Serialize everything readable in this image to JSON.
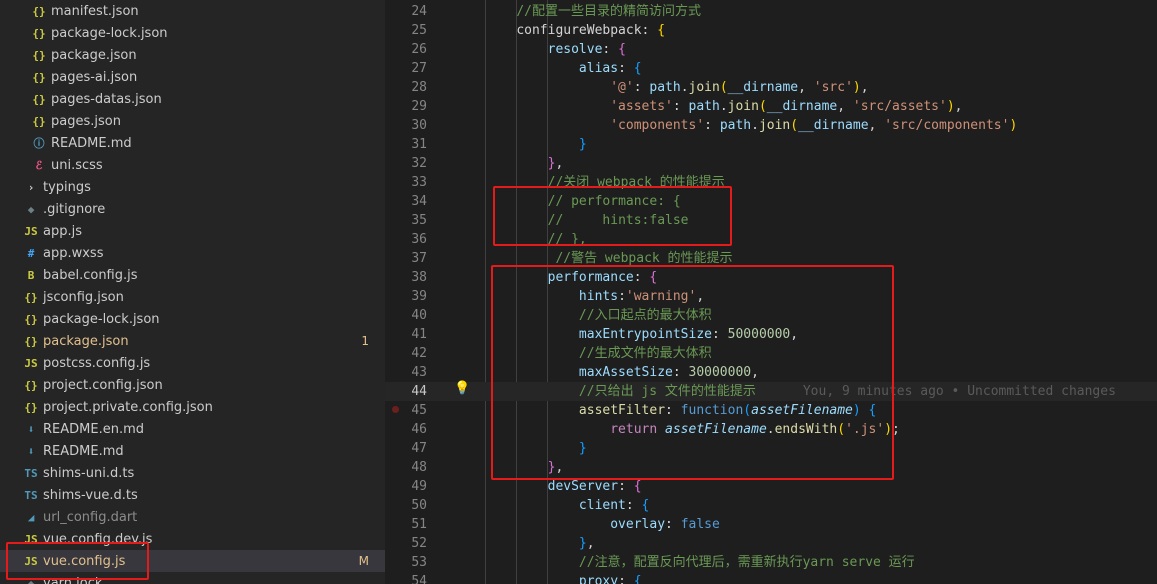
{
  "explorer": {
    "items": [
      {
        "label": "manifest.json",
        "icon": "{}",
        "icon_color": "#cbcb41",
        "indent": 32,
        "color": "#cccccc"
      },
      {
        "label": "package-lock.json",
        "icon": "{}",
        "icon_color": "#cbcb41",
        "indent": 32,
        "color": "#cccccc"
      },
      {
        "label": "package.json",
        "icon": "{}",
        "icon_color": "#cbcb41",
        "indent": 32,
        "color": "#cccccc"
      },
      {
        "label": "pages-ai.json",
        "icon": "{}",
        "icon_color": "#cbcb41",
        "indent": 32,
        "color": "#cccccc"
      },
      {
        "label": "pages-datas.json",
        "icon": "{}",
        "icon_color": "#cbcb41",
        "indent": 32,
        "color": "#cccccc"
      },
      {
        "label": "pages.json",
        "icon": "{}",
        "icon_color": "#cbcb41",
        "indent": 32,
        "color": "#cccccc"
      },
      {
        "label": "README.md",
        "icon": "ⓘ",
        "icon_color": "#519aba",
        "indent": 32,
        "color": "#cccccc"
      },
      {
        "label": "uni.scss",
        "icon": "ℰ",
        "icon_color": "#f55385",
        "indent": 32,
        "color": "#cccccc"
      },
      {
        "label": "typings",
        "icon": "›",
        "icon_color": "#cccccc",
        "indent": 24,
        "color": "#cccccc"
      },
      {
        "label": ".gitignore",
        "icon": "◆",
        "icon_color": "#6d8086",
        "indent": 24,
        "color": "#cccccc"
      },
      {
        "label": "app.js",
        "icon": "JS",
        "icon_color": "#cbcb41",
        "indent": 24,
        "color": "#cccccc"
      },
      {
        "label": "app.wxss",
        "icon": "#",
        "icon_color": "#42a5f5",
        "indent": 24,
        "color": "#cccccc"
      },
      {
        "label": "babel.config.js",
        "icon": "B",
        "icon_color": "#cbcb41",
        "indent": 24,
        "color": "#cccccc"
      },
      {
        "label": "jsconfig.json",
        "icon": "{}",
        "icon_color": "#cbcb41",
        "indent": 24,
        "color": "#cccccc"
      },
      {
        "label": "package-lock.json",
        "icon": "{}",
        "icon_color": "#cbcb41",
        "indent": 24,
        "color": "#cccccc"
      },
      {
        "label": "package.json",
        "icon": "{}",
        "icon_color": "#cbcb41",
        "indent": 24,
        "color": "#e2c08d",
        "badge": "1"
      },
      {
        "label": "postcss.config.js",
        "icon": "JS",
        "icon_color": "#cbcb41",
        "indent": 24,
        "color": "#cccccc"
      },
      {
        "label": "project.config.json",
        "icon": "{}",
        "icon_color": "#cbcb41",
        "indent": 24,
        "color": "#cccccc"
      },
      {
        "label": "project.private.config.json",
        "icon": "{}",
        "icon_color": "#cbcb41",
        "indent": 24,
        "color": "#cccccc"
      },
      {
        "label": "README.en.md",
        "icon": "⬇",
        "icon_color": "#519aba",
        "indent": 24,
        "color": "#cccccc"
      },
      {
        "label": "README.md",
        "icon": "⬇",
        "icon_color": "#519aba",
        "indent": 24,
        "color": "#cccccc"
      },
      {
        "label": "shims-uni.d.ts",
        "icon": "TS",
        "icon_color": "#519aba",
        "indent": 24,
        "color": "#cccccc"
      },
      {
        "label": "shims-vue.d.ts",
        "icon": "TS",
        "icon_color": "#519aba",
        "indent": 24,
        "color": "#cccccc"
      },
      {
        "label": "url_config.dart",
        "icon": "◢",
        "icon_color": "#519aba",
        "indent": 24,
        "color": "#8c8c8c"
      },
      {
        "label": "vue.config.dev.js",
        "icon": "JS",
        "icon_color": "#cbcb41",
        "indent": 24,
        "color": "#cccccc"
      },
      {
        "label": "vue.config.js",
        "icon": "JS",
        "icon_color": "#cbcb41",
        "indent": 24,
        "color": "#e2c08d",
        "badge": "M",
        "selected": true
      },
      {
        "label": "yarn.lock",
        "icon": "◆",
        "icon_color": "#6d8086",
        "indent": 24,
        "color": "#cccccc"
      }
    ]
  },
  "editor": {
    "active_line": 44,
    "blame_text": "You, 9 minutes ago • Uncommitted changes",
    "lines": [
      {
        "n": 24,
        "tokens": [
          [
            "    ",
            ""
          ],
          [
            "//配置一些目录的精简访问方式",
            "c-cmt"
          ]
        ]
      },
      {
        "n": 25,
        "tokens": [
          [
            "    ",
            ""
          ],
          [
            "configureWebpack",
            ""
          ],
          [
            ": ",
            ""
          ],
          [
            "{",
            "c-br1"
          ]
        ]
      },
      {
        "n": 26,
        "tokens": [
          [
            "        ",
            ""
          ],
          [
            "resolve",
            "c-key"
          ],
          [
            ": ",
            ""
          ],
          [
            "{",
            "c-br2"
          ]
        ]
      },
      {
        "n": 27,
        "tokens": [
          [
            "            ",
            ""
          ],
          [
            "alias",
            "c-key"
          ],
          [
            ": ",
            ""
          ],
          [
            "{",
            "c-br3"
          ]
        ]
      },
      {
        "n": 28,
        "tokens": [
          [
            "                ",
            ""
          ],
          [
            "'@'",
            "c-str"
          ],
          [
            ": ",
            ""
          ],
          [
            "path",
            "c-key"
          ],
          [
            ".",
            ""
          ],
          [
            "join",
            "c-fn"
          ],
          [
            "(",
            "c-br1"
          ],
          [
            "__dirname",
            "c-key"
          ],
          [
            ", ",
            ""
          ],
          [
            "'src'",
            "c-str"
          ],
          [
            ")",
            "c-br1"
          ],
          [
            ",",
            ""
          ]
        ]
      },
      {
        "n": 29,
        "tokens": [
          [
            "                ",
            ""
          ],
          [
            "'assets'",
            "c-str"
          ],
          [
            ": ",
            ""
          ],
          [
            "path",
            "c-key"
          ],
          [
            ".",
            ""
          ],
          [
            "join",
            "c-fn"
          ],
          [
            "(",
            "c-br1"
          ],
          [
            "__dirname",
            "c-key"
          ],
          [
            ", ",
            ""
          ],
          [
            "'src/assets'",
            "c-str"
          ],
          [
            ")",
            "c-br1"
          ],
          [
            ",",
            ""
          ]
        ]
      },
      {
        "n": 30,
        "tokens": [
          [
            "                ",
            ""
          ],
          [
            "'components'",
            "c-str"
          ],
          [
            ": ",
            ""
          ],
          [
            "path",
            "c-key"
          ],
          [
            ".",
            ""
          ],
          [
            "join",
            "c-fn"
          ],
          [
            "(",
            "c-br1"
          ],
          [
            "__dirname",
            "c-key"
          ],
          [
            ", ",
            ""
          ],
          [
            "'src/components'",
            "c-str"
          ],
          [
            ")",
            "c-br1"
          ]
        ]
      },
      {
        "n": 31,
        "tokens": [
          [
            "            ",
            ""
          ],
          [
            "}",
            "c-br3"
          ]
        ]
      },
      {
        "n": 32,
        "tokens": [
          [
            "        ",
            ""
          ],
          [
            "}",
            "c-br2"
          ],
          [
            ",",
            ""
          ]
        ]
      },
      {
        "n": 33,
        "tokens": [
          [
            "        ",
            ""
          ],
          [
            "//关闭 webpack 的性能提示",
            "c-cmt"
          ]
        ]
      },
      {
        "n": 34,
        "tokens": [
          [
            "        ",
            ""
          ],
          [
            "// performance: {",
            "c-cmt"
          ]
        ]
      },
      {
        "n": 35,
        "tokens": [
          [
            "        ",
            ""
          ],
          [
            "//     hints:false",
            "c-cmt"
          ]
        ]
      },
      {
        "n": 36,
        "tokens": [
          [
            "        ",
            ""
          ],
          [
            "// },",
            "c-cmt"
          ]
        ]
      },
      {
        "n": 37,
        "tokens": [
          [
            "         ",
            ""
          ],
          [
            "//警告 webpack 的性能提示",
            "c-cmt"
          ]
        ]
      },
      {
        "n": 38,
        "tokens": [
          [
            "        ",
            ""
          ],
          [
            "performance",
            "c-key"
          ],
          [
            ": ",
            ""
          ],
          [
            "{",
            "c-br2"
          ]
        ]
      },
      {
        "n": 39,
        "tokens": [
          [
            "            ",
            ""
          ],
          [
            "hints",
            "c-key"
          ],
          [
            ":",
            ""
          ],
          [
            "'warning'",
            "c-str"
          ],
          [
            ",",
            ""
          ]
        ]
      },
      {
        "n": 40,
        "tokens": [
          [
            "            ",
            ""
          ],
          [
            "//入口起点的最大体积",
            "c-cmt"
          ]
        ]
      },
      {
        "n": 41,
        "tokens": [
          [
            "            ",
            ""
          ],
          [
            "maxEntrypointSize",
            "c-key"
          ],
          [
            ": ",
            ""
          ],
          [
            "50000000",
            "c-num"
          ],
          [
            ",",
            ""
          ]
        ]
      },
      {
        "n": 42,
        "tokens": [
          [
            "            ",
            ""
          ],
          [
            "//生成文件的最大体积",
            "c-cmt"
          ]
        ]
      },
      {
        "n": 43,
        "tokens": [
          [
            "            ",
            ""
          ],
          [
            "maxAssetSize",
            "c-key"
          ],
          [
            ": ",
            ""
          ],
          [
            "30000000",
            "c-num"
          ],
          [
            ",",
            ""
          ]
        ]
      },
      {
        "n": 44,
        "tokens": [
          [
            "            ",
            ""
          ],
          [
            "//只给出 js 文件的性能提示",
            "c-cmt"
          ]
        ]
      },
      {
        "n": 45,
        "tokens": [
          [
            "            ",
            ""
          ],
          [
            "assetFilter",
            "c-fn"
          ],
          [
            ": ",
            ""
          ],
          [
            "function",
            "c-kw"
          ],
          [
            "(",
            "c-br3"
          ],
          [
            "assetFilename",
            "c-param"
          ],
          [
            ")",
            "c-br3"
          ],
          [
            " ",
            ""
          ],
          [
            "{",
            "c-br3"
          ]
        ]
      },
      {
        "n": 46,
        "tokens": [
          [
            "                ",
            ""
          ],
          [
            "return",
            "c-ctl"
          ],
          [
            " ",
            ""
          ],
          [
            "assetFilename",
            "c-param"
          ],
          [
            ".",
            ""
          ],
          [
            "endsWith",
            "c-fn"
          ],
          [
            "(",
            "c-br1"
          ],
          [
            "'.js'",
            "c-str"
          ],
          [
            ")",
            "c-br1"
          ],
          [
            ";",
            ""
          ]
        ]
      },
      {
        "n": 47,
        "tokens": [
          [
            "            ",
            ""
          ],
          [
            "}",
            "c-br3"
          ]
        ]
      },
      {
        "n": 48,
        "tokens": [
          [
            "        ",
            ""
          ],
          [
            "}",
            "c-br2"
          ],
          [
            ",",
            ""
          ]
        ]
      },
      {
        "n": 49,
        "tokens": [
          [
            "        ",
            ""
          ],
          [
            "devServer",
            "c-key"
          ],
          [
            ": ",
            ""
          ],
          [
            "{",
            "c-br2"
          ]
        ]
      },
      {
        "n": 50,
        "tokens": [
          [
            "            ",
            ""
          ],
          [
            "client",
            "c-key"
          ],
          [
            ": ",
            ""
          ],
          [
            "{",
            "c-br3"
          ]
        ]
      },
      {
        "n": 51,
        "tokens": [
          [
            "                ",
            ""
          ],
          [
            "overlay",
            "c-key"
          ],
          [
            ": ",
            ""
          ],
          [
            "false",
            "c-kw"
          ]
        ]
      },
      {
        "n": 52,
        "tokens": [
          [
            "            ",
            ""
          ],
          [
            "}",
            "c-br3"
          ],
          [
            ",",
            ""
          ]
        ]
      },
      {
        "n": 53,
        "tokens": [
          [
            "            ",
            ""
          ],
          [
            "//注意，配置反向代理后，需重新执行yarn serve 运行",
            "c-cmt"
          ]
        ]
      },
      {
        "n": 54,
        "tokens": [
          [
            "            ",
            ""
          ],
          [
            "proxy",
            "c-key"
          ],
          [
            ": ",
            ""
          ],
          [
            "{",
            "c-br3"
          ]
        ]
      }
    ]
  },
  "colors": {
    "highlight_box": "#e51a1a",
    "modified": "#e2c08d"
  }
}
